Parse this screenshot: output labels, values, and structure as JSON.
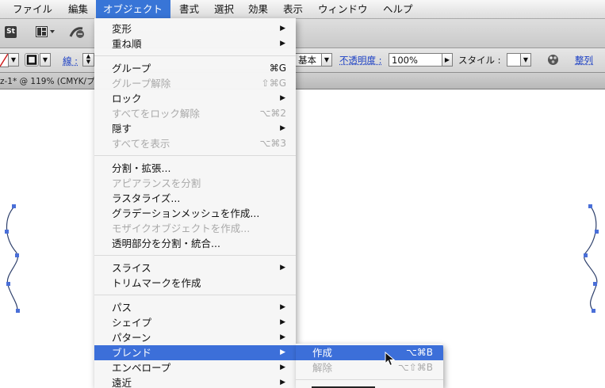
{
  "menubar": {
    "items": [
      "ファイル",
      "編集",
      "オブジェクト",
      "書式",
      "選択",
      "効果",
      "表示",
      "ウィンドウ",
      "ヘルプ"
    ]
  },
  "toolbar": {
    "stock_label": "St"
  },
  "controlbar": {
    "stroke_label": "線 :",
    "profile_value": "基本",
    "opacity_label": "不透明度 :",
    "opacity_value": "100%",
    "style_label": "スタイル :",
    "align_label": "整列"
  },
  "document": {
    "tab_title": "z-1* @ 119% (CMYK/プ"
  },
  "object_menu": {
    "items": [
      {
        "label": "変形",
        "submenu": true
      },
      {
        "label": "重ね順",
        "submenu": true
      },
      {
        "label": "グループ",
        "shortcut": "⌘G"
      },
      {
        "label": "グループ解除",
        "shortcut": "⇧⌘G",
        "disabled": true
      },
      {
        "label": "ロック",
        "submenu": true
      },
      {
        "label": "すべてをロック解除",
        "shortcut": "⌥⌘2",
        "disabled": true
      },
      {
        "label": "隠す",
        "submenu": true
      },
      {
        "label": "すべてを表示",
        "shortcut": "⌥⌘3",
        "disabled": true
      },
      {
        "label": "分割・拡張..."
      },
      {
        "label": "アピアランスを分割",
        "disabled": true
      },
      {
        "label": "ラスタライズ..."
      },
      {
        "label": "グラデーションメッシュを作成..."
      },
      {
        "label": "モザイクオブジェクトを作成...",
        "disabled": true
      },
      {
        "label": "透明部分を分割・統合..."
      },
      {
        "label": "スライス",
        "submenu": true
      },
      {
        "label": "トリムマークを作成"
      },
      {
        "label": "パス",
        "submenu": true
      },
      {
        "label": "シェイプ",
        "submenu": true
      },
      {
        "label": "パターン",
        "submenu": true
      },
      {
        "label": "ブレンド",
        "submenu": true,
        "highlighted": true
      },
      {
        "label": "エンベロープ",
        "submenu": true
      },
      {
        "label": "遠近",
        "submenu": true
      }
    ]
  },
  "blend_submenu": {
    "items": [
      {
        "label": "作成",
        "shortcut": "⌥⌘B",
        "highlighted": true
      },
      {
        "label": "解除",
        "shortcut": "⌥⇧⌘B",
        "disabled": true
      }
    ]
  },
  "colors": {
    "menu_highlight": "#3c6fd9",
    "menubar_active": "#3875d7",
    "path_stroke": "#2d3f6b",
    "anchor_point": "#4a6fd8"
  }
}
